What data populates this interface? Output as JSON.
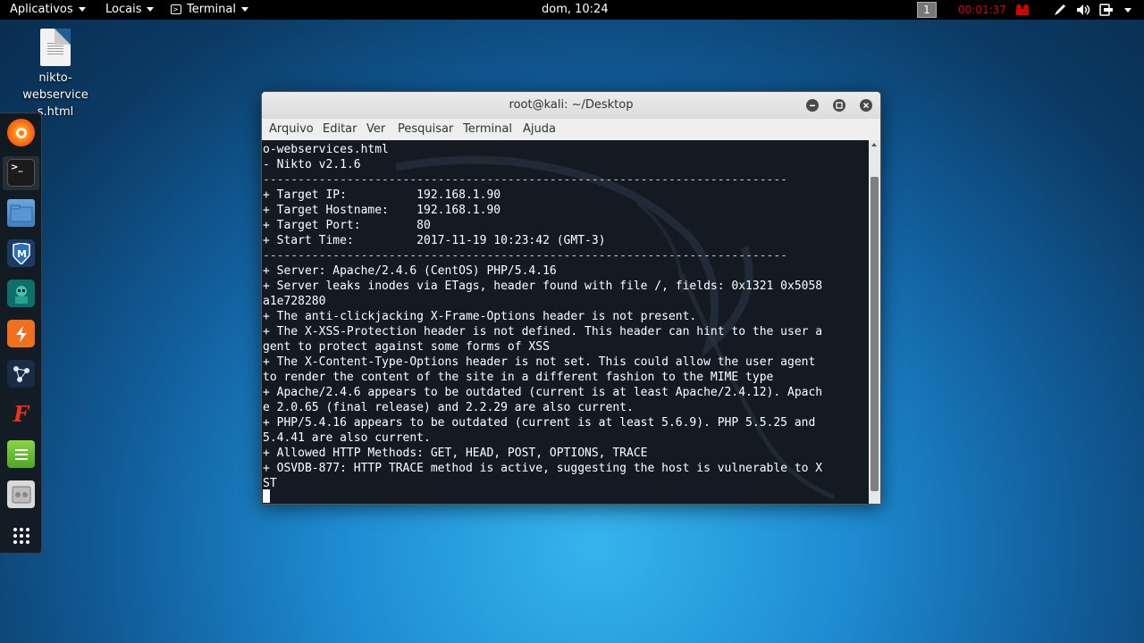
{
  "topbar": {
    "applications": "Aplicativos",
    "places": "Locais",
    "terminal_app": "Terminal",
    "clock": "dom, 10:24",
    "workspace": "1",
    "record_time": "00:01:37"
  },
  "desktop": {
    "file_name_lines": [
      "nikto-",
      "webservice",
      "s.html"
    ]
  },
  "dock": {
    "items": [
      "firefox-icon",
      "terminal-icon",
      "files-icon",
      "metasploit-icon",
      "armitage-icon",
      "burpsuite-icon",
      "maltego-icon",
      "faraday-icon",
      "leafpad-icon",
      "cherrytree-icon",
      "show-apps-icon"
    ]
  },
  "window": {
    "title": "root@kali: ~/Desktop",
    "menu": [
      "Arquivo",
      "Editar",
      "Ver",
      "Pesquisar",
      "Terminal",
      "Ajuda"
    ]
  },
  "terminal": {
    "lines": [
      "o-webservices.html",
      "- Nikto v2.1.6",
      "---------------------------------------------------------------------------",
      "+ Target IP:          192.168.1.90",
      "+ Target Hostname:    192.168.1.90",
      "+ Target Port:        80",
      "+ Start Time:         2017-11-19 10:23:42 (GMT-3)",
      "---------------------------------------------------------------------------",
      "+ Server: Apache/2.4.6 (CentOS) PHP/5.4.16",
      "+ Server leaks inodes via ETags, header found with file /, fields: 0x1321 0x5058",
      "a1e728280",
      "+ The anti-clickjacking X-Frame-Options header is not present.",
      "+ The X-XSS-Protection header is not defined. This header can hint to the user a",
      "gent to protect against some forms of XSS",
      "+ The X-Content-Type-Options header is not set. This could allow the user agent",
      "to render the content of the site in a different fashion to the MIME type",
      "+ Apache/2.4.6 appears to be outdated (current is at least Apache/2.4.12). Apach",
      "e 2.0.65 (final release) and 2.2.29 are also current.",
      "+ PHP/5.4.16 appears to be outdated (current is at least 5.6.9). PHP 5.5.25 and",
      "5.4.41 are also current.",
      "+ Allowed HTTP Methods: GET, HEAD, POST, OPTIONS, TRACE",
      "+ OSVDB-877: HTTP TRACE method is active, suggesting the host is vulnerable to X",
      "ST"
    ]
  },
  "colors": {
    "record": "#d40000",
    "terminal_bg": "#060e16",
    "desktop_accent": "#1e8cd2"
  }
}
